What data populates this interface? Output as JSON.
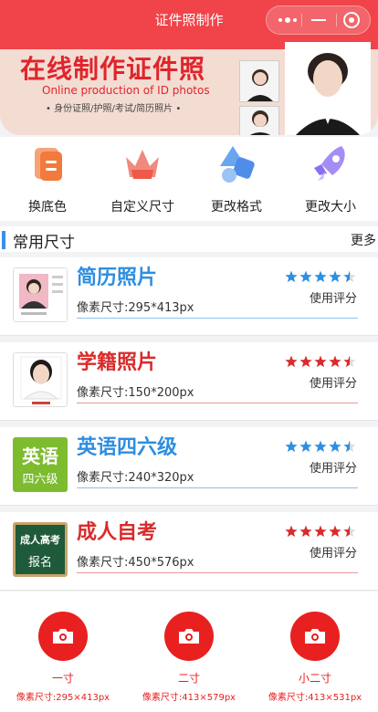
{
  "topbar": {
    "title": "证件照制作"
  },
  "banner": {
    "title": "在线制作证件照",
    "subtitle": "Online production of ID photos",
    "tags": "• 身份证照/护照/考试/简历照片 •"
  },
  "features": [
    {
      "label": "换底色",
      "icon": "document-icon",
      "color": "#f27a3c"
    },
    {
      "label": "自定义尺寸",
      "icon": "crown-icon",
      "color": "#ee5a4a"
    },
    {
      "label": "更改格式",
      "icon": "shapes-icon",
      "color": "#4f8de8"
    },
    {
      "label": "更改大小",
      "icon": "rocket-icon",
      "color": "#8c6ff0"
    }
  ],
  "section": {
    "title": "常用尺寸",
    "more": "更多"
  },
  "cards": [
    {
      "name": "简历照片",
      "size": "像素尺寸:295*413px",
      "rating_label": "使用评分",
      "rating": 4.5,
      "accent": "#2e8ee0"
    },
    {
      "name": "学籍照片",
      "size": "像素尺寸:150*200px",
      "rating_label": "使用评分",
      "rating": 4.5,
      "accent": "#d92b2b"
    },
    {
      "name": "英语四六级",
      "size": "像素尺寸:240*320px",
      "rating_label": "使用评分",
      "rating": 4.5,
      "accent": "#2e8ee0",
      "thumb_text_1": "英语",
      "thumb_text_2": "四六级"
    },
    {
      "name": "成人自考",
      "size": "像素尺寸:450*576px",
      "rating_label": "使用评分",
      "rating": 4.5,
      "accent": "#d92b2b",
      "thumb_text_1": "成人高考",
      "thumb_text_2": "报名"
    }
  ],
  "bottom_buttons": [
    {
      "name": "一寸",
      "size": "像素尺寸:295×413px"
    },
    {
      "name": "二寸",
      "size": "像素尺寸:413×579px"
    },
    {
      "name": "小二寸",
      "size": "像素尺寸:413×531px"
    }
  ]
}
